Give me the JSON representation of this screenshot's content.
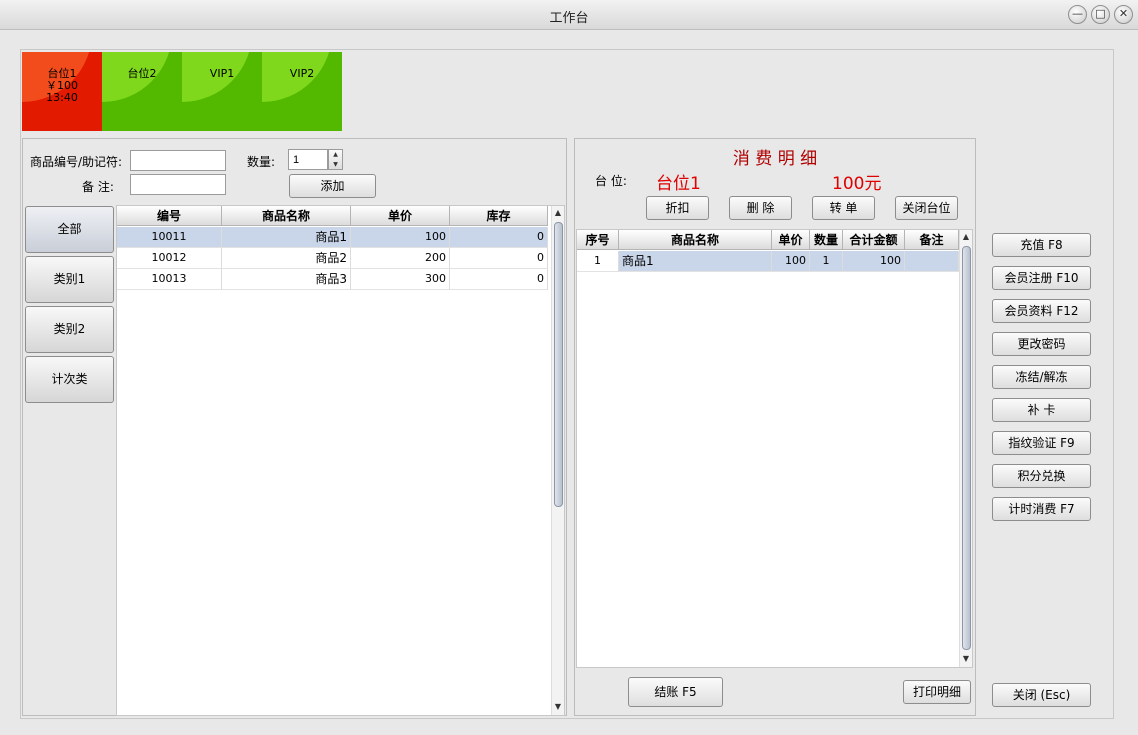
{
  "window": {
    "title": "工作台",
    "min_glyph": "—",
    "max_glyph": "□",
    "close_glyph": "✕"
  },
  "tables": [
    {
      "name": "台位1",
      "amount": "￥100",
      "time": "13:40",
      "state": "occupied"
    },
    {
      "name": "台位2"
    },
    {
      "name": "VIP1"
    },
    {
      "name": "VIP2"
    }
  ],
  "product_form": {
    "code_label": "商品编号/助记符:",
    "code_value": "",
    "qty_label": "数量:",
    "qty_value": "1",
    "note_label": "备 注:",
    "note_value": "",
    "add_button": "添加",
    "spin_up": "▲",
    "spin_down": "▼"
  },
  "categories": [
    "全部",
    "类别1",
    "类别2",
    "计次类"
  ],
  "products": {
    "headers": [
      "编号",
      "商品名称",
      "单价",
      "库存"
    ],
    "rows": [
      {
        "code": "10011",
        "name": "商品1",
        "price": "100",
        "stock": "0"
      },
      {
        "code": "10012",
        "name": "商品2",
        "price": "200",
        "stock": "0"
      },
      {
        "code": "10013",
        "name": "商品3",
        "price": "300",
        "stock": "0"
      }
    ]
  },
  "detail": {
    "title": "消 费 明 细",
    "table_label": "台 位:",
    "table_value": "台位1",
    "total": "100元",
    "buttons": [
      "折扣",
      "删 除",
      "转 单",
      "关闭台位"
    ],
    "headers": [
      "序号",
      "商品名称",
      "单价",
      "数量",
      "合计金额",
      "备注"
    ],
    "rows": [
      {
        "no": "1",
        "name": "商品1",
        "price": "100",
        "qty": "1",
        "sum": "100",
        "note": ""
      }
    ],
    "checkout_button": "结账  F5",
    "print_button": "打印明细"
  },
  "side_buttons": [
    "充值 F8",
    "会员注册 F10",
    "会员资料 F12",
    "更改密码",
    "冻结/解冻",
    "补 卡",
    "指纹验证 F9",
    "积分兑换",
    "计时消费  F7"
  ],
  "close_button": "关闭 (Esc)",
  "scroll_glyphs": {
    "up": "▲",
    "down": "▼"
  },
  "colors": {
    "accent_red": "#e00000",
    "title_red": "#b00000",
    "tile_green": "#53b800",
    "tile_red": "#e21a00",
    "selection": "#c9d5e8"
  }
}
